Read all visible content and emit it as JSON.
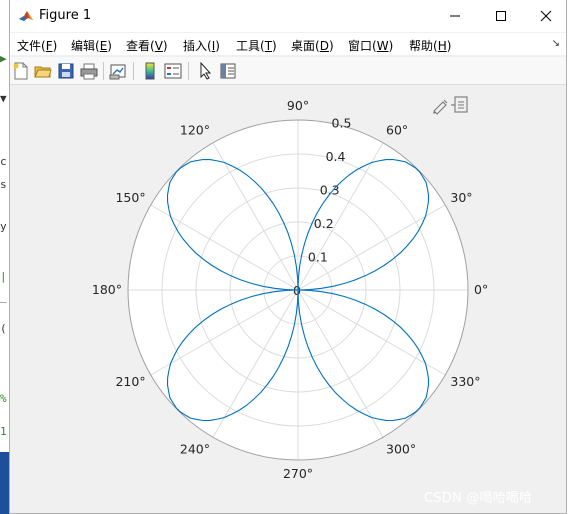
{
  "window": {
    "title": "Figure 1",
    "icon": "matlab-logo-icon"
  },
  "titlebar_buttons": {
    "minimize_icon": "minimize-icon",
    "maximize_icon": "maximize-icon",
    "close_icon": "close-icon"
  },
  "menu": {
    "items": [
      {
        "label": "文件(",
        "key": "F",
        "tail": ")"
      },
      {
        "label": "编辑(",
        "key": "E",
        "tail": ")"
      },
      {
        "label": "查看(",
        "key": "V",
        "tail": ")"
      },
      {
        "label": "插入(",
        "key": "I",
        "tail": ")"
      },
      {
        "label": "工具(",
        "key": "T",
        "tail": ")"
      },
      {
        "label": "桌面(",
        "key": "D",
        "tail": ")"
      },
      {
        "label": "窗口(",
        "key": "W",
        "tail": ")"
      },
      {
        "label": "帮助(",
        "key": "H",
        "tail": ")"
      }
    ],
    "overflow_icon": "menu-dock-arrow-icon"
  },
  "toolbar": {
    "buttons": [
      "new-figure-icon",
      "open-file-icon",
      "save-icon",
      "print-icon",
      "link-plot-icon",
      "insert-colorbar-icon",
      "insert-legend-icon",
      "pointer-edit-icon",
      "property-inspector-icon"
    ]
  },
  "axes_toolbar": {
    "buttons": [
      "brush-edit-icon",
      "export-icon"
    ]
  },
  "chart_data": {
    "type": "polar",
    "title": "",
    "rlim": [
      0,
      0.5
    ],
    "r_ticks": [
      0,
      0.1,
      0.2,
      0.3,
      0.4,
      0.5
    ],
    "r_tick_labels": [
      "0",
      "0.1",
      "0.2",
      "0.3",
      "0.4",
      "0.5"
    ],
    "theta_ticks": [
      0,
      30,
      60,
      90,
      120,
      150,
      180,
      210,
      240,
      270,
      300,
      330
    ],
    "theta_tick_labels": [
      "0°",
      "30°",
      "60°",
      "90°",
      "120°",
      "150°",
      "180°",
      "210°",
      "240°",
      "270°",
      "300°",
      "330°"
    ],
    "grid": true,
    "series": [
      {
        "curve": "four-petal rose",
        "petal_peak_r": 0.5,
        "petal_directions_deg": [
          45,
          135,
          225,
          315
        ],
        "theta_deg": [
          0,
          5,
          10,
          15,
          20,
          25,
          30,
          35,
          40,
          45,
          50,
          55,
          60,
          65,
          70,
          75,
          80,
          85,
          90
        ],
        "r": [
          0,
          0.087,
          0.171,
          0.25,
          0.321,
          0.383,
          0.433,
          0.47,
          0.492,
          0.5,
          0.492,
          0.47,
          0.433,
          0.383,
          0.321,
          0.25,
          0.171,
          0.087,
          0
        ],
        "color": "#0072bd"
      }
    ]
  },
  "watermark": "CSDN @喝哈喝哈",
  "colors": {
    "figure_bg": "#f0f0f0",
    "axes_bg": "#ffffff",
    "grid": "#dcdcdc",
    "axis_outline": "#262626",
    "line": "#0072bd"
  }
}
